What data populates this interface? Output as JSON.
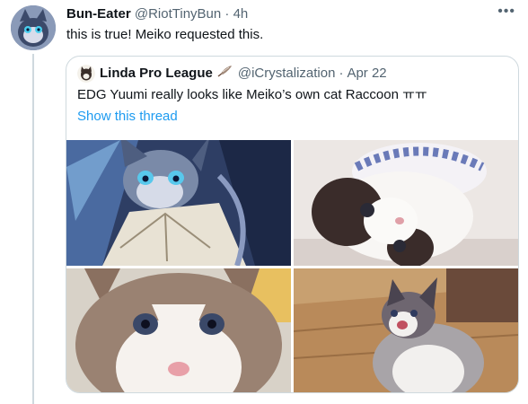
{
  "tweet": {
    "author_name": "Bun-Eater",
    "author_handle": "@RiotTinyBun",
    "separator": "·",
    "time": "4h",
    "text": "this is true! Meiko requested this.",
    "more_icon": "more-horizontal-icon"
  },
  "quoted": {
    "author_name": "Linda Pro League",
    "author_handle": "@iCrystalization",
    "separator": "·",
    "date": "Apr 22",
    "text": "EDG Yuumi really looks like Meiko’s own cat Raccoon ㅠㅠ",
    "show_thread": "Show this thread",
    "name_emoji": "feather-icon",
    "images": [
      {
        "name": "yuumi-artwork-image"
      },
      {
        "name": "cat-with-lace-hat-image"
      },
      {
        "name": "cat-closeup-image"
      },
      {
        "name": "cat-licking-nose-image"
      }
    ]
  }
}
